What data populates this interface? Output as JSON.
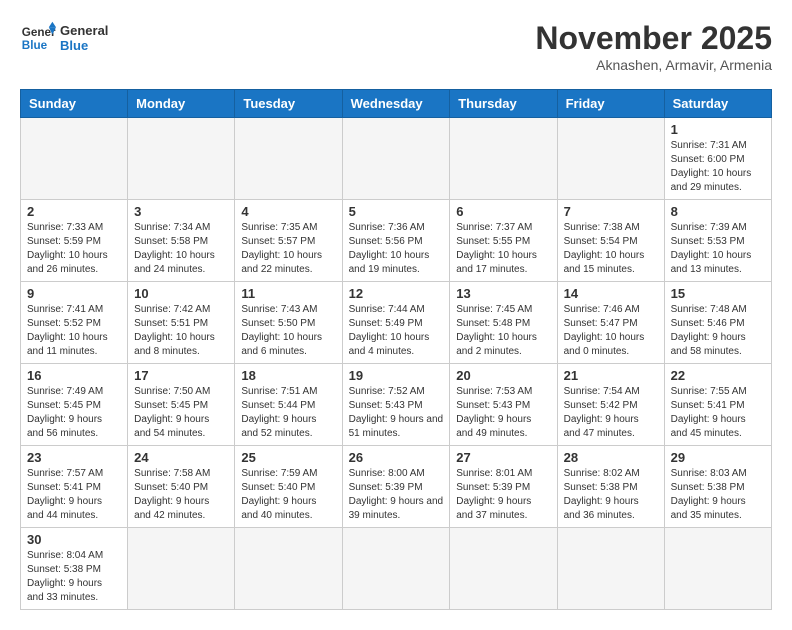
{
  "logo": {
    "general": "General",
    "blue": "Blue"
  },
  "header": {
    "month": "November 2025",
    "location": "Aknashen, Armavir, Armenia"
  },
  "weekdays": [
    "Sunday",
    "Monday",
    "Tuesday",
    "Wednesday",
    "Thursday",
    "Friday",
    "Saturday"
  ],
  "weeks": [
    [
      {
        "day": "",
        "info": ""
      },
      {
        "day": "",
        "info": ""
      },
      {
        "day": "",
        "info": ""
      },
      {
        "day": "",
        "info": ""
      },
      {
        "day": "",
        "info": ""
      },
      {
        "day": "",
        "info": ""
      },
      {
        "day": "1",
        "info": "Sunrise: 7:31 AM\nSunset: 6:00 PM\nDaylight: 10 hours and 29 minutes."
      }
    ],
    [
      {
        "day": "2",
        "info": "Sunrise: 7:33 AM\nSunset: 5:59 PM\nDaylight: 10 hours and 26 minutes."
      },
      {
        "day": "3",
        "info": "Sunrise: 7:34 AM\nSunset: 5:58 PM\nDaylight: 10 hours and 24 minutes."
      },
      {
        "day": "4",
        "info": "Sunrise: 7:35 AM\nSunset: 5:57 PM\nDaylight: 10 hours and 22 minutes."
      },
      {
        "day": "5",
        "info": "Sunrise: 7:36 AM\nSunset: 5:56 PM\nDaylight: 10 hours and 19 minutes."
      },
      {
        "day": "6",
        "info": "Sunrise: 7:37 AM\nSunset: 5:55 PM\nDaylight: 10 hours and 17 minutes."
      },
      {
        "day": "7",
        "info": "Sunrise: 7:38 AM\nSunset: 5:54 PM\nDaylight: 10 hours and 15 minutes."
      },
      {
        "day": "8",
        "info": "Sunrise: 7:39 AM\nSunset: 5:53 PM\nDaylight: 10 hours and 13 minutes."
      }
    ],
    [
      {
        "day": "9",
        "info": "Sunrise: 7:41 AM\nSunset: 5:52 PM\nDaylight: 10 hours and 11 minutes."
      },
      {
        "day": "10",
        "info": "Sunrise: 7:42 AM\nSunset: 5:51 PM\nDaylight: 10 hours and 8 minutes."
      },
      {
        "day": "11",
        "info": "Sunrise: 7:43 AM\nSunset: 5:50 PM\nDaylight: 10 hours and 6 minutes."
      },
      {
        "day": "12",
        "info": "Sunrise: 7:44 AM\nSunset: 5:49 PM\nDaylight: 10 hours and 4 minutes."
      },
      {
        "day": "13",
        "info": "Sunrise: 7:45 AM\nSunset: 5:48 PM\nDaylight: 10 hours and 2 minutes."
      },
      {
        "day": "14",
        "info": "Sunrise: 7:46 AM\nSunset: 5:47 PM\nDaylight: 10 hours and 0 minutes."
      },
      {
        "day": "15",
        "info": "Sunrise: 7:48 AM\nSunset: 5:46 PM\nDaylight: 9 hours and 58 minutes."
      }
    ],
    [
      {
        "day": "16",
        "info": "Sunrise: 7:49 AM\nSunset: 5:45 PM\nDaylight: 9 hours and 56 minutes."
      },
      {
        "day": "17",
        "info": "Sunrise: 7:50 AM\nSunset: 5:45 PM\nDaylight: 9 hours and 54 minutes."
      },
      {
        "day": "18",
        "info": "Sunrise: 7:51 AM\nSunset: 5:44 PM\nDaylight: 9 hours and 52 minutes."
      },
      {
        "day": "19",
        "info": "Sunrise: 7:52 AM\nSunset: 5:43 PM\nDaylight: 9 hours and 51 minutes."
      },
      {
        "day": "20",
        "info": "Sunrise: 7:53 AM\nSunset: 5:43 PM\nDaylight: 9 hours and 49 minutes."
      },
      {
        "day": "21",
        "info": "Sunrise: 7:54 AM\nSunset: 5:42 PM\nDaylight: 9 hours and 47 minutes."
      },
      {
        "day": "22",
        "info": "Sunrise: 7:55 AM\nSunset: 5:41 PM\nDaylight: 9 hours and 45 minutes."
      }
    ],
    [
      {
        "day": "23",
        "info": "Sunrise: 7:57 AM\nSunset: 5:41 PM\nDaylight: 9 hours and 44 minutes."
      },
      {
        "day": "24",
        "info": "Sunrise: 7:58 AM\nSunset: 5:40 PM\nDaylight: 9 hours and 42 minutes."
      },
      {
        "day": "25",
        "info": "Sunrise: 7:59 AM\nSunset: 5:40 PM\nDaylight: 9 hours and 40 minutes."
      },
      {
        "day": "26",
        "info": "Sunrise: 8:00 AM\nSunset: 5:39 PM\nDaylight: 9 hours and 39 minutes."
      },
      {
        "day": "27",
        "info": "Sunrise: 8:01 AM\nSunset: 5:39 PM\nDaylight: 9 hours and 37 minutes."
      },
      {
        "day": "28",
        "info": "Sunrise: 8:02 AM\nSunset: 5:38 PM\nDaylight: 9 hours and 36 minutes."
      },
      {
        "day": "29",
        "info": "Sunrise: 8:03 AM\nSunset: 5:38 PM\nDaylight: 9 hours and 35 minutes."
      }
    ],
    [
      {
        "day": "30",
        "info": "Sunrise: 8:04 AM\nSunset: 5:38 PM\nDaylight: 9 hours and 33 minutes."
      },
      {
        "day": "",
        "info": ""
      },
      {
        "day": "",
        "info": ""
      },
      {
        "day": "",
        "info": ""
      },
      {
        "day": "",
        "info": ""
      },
      {
        "day": "",
        "info": ""
      },
      {
        "day": "",
        "info": ""
      }
    ]
  ]
}
